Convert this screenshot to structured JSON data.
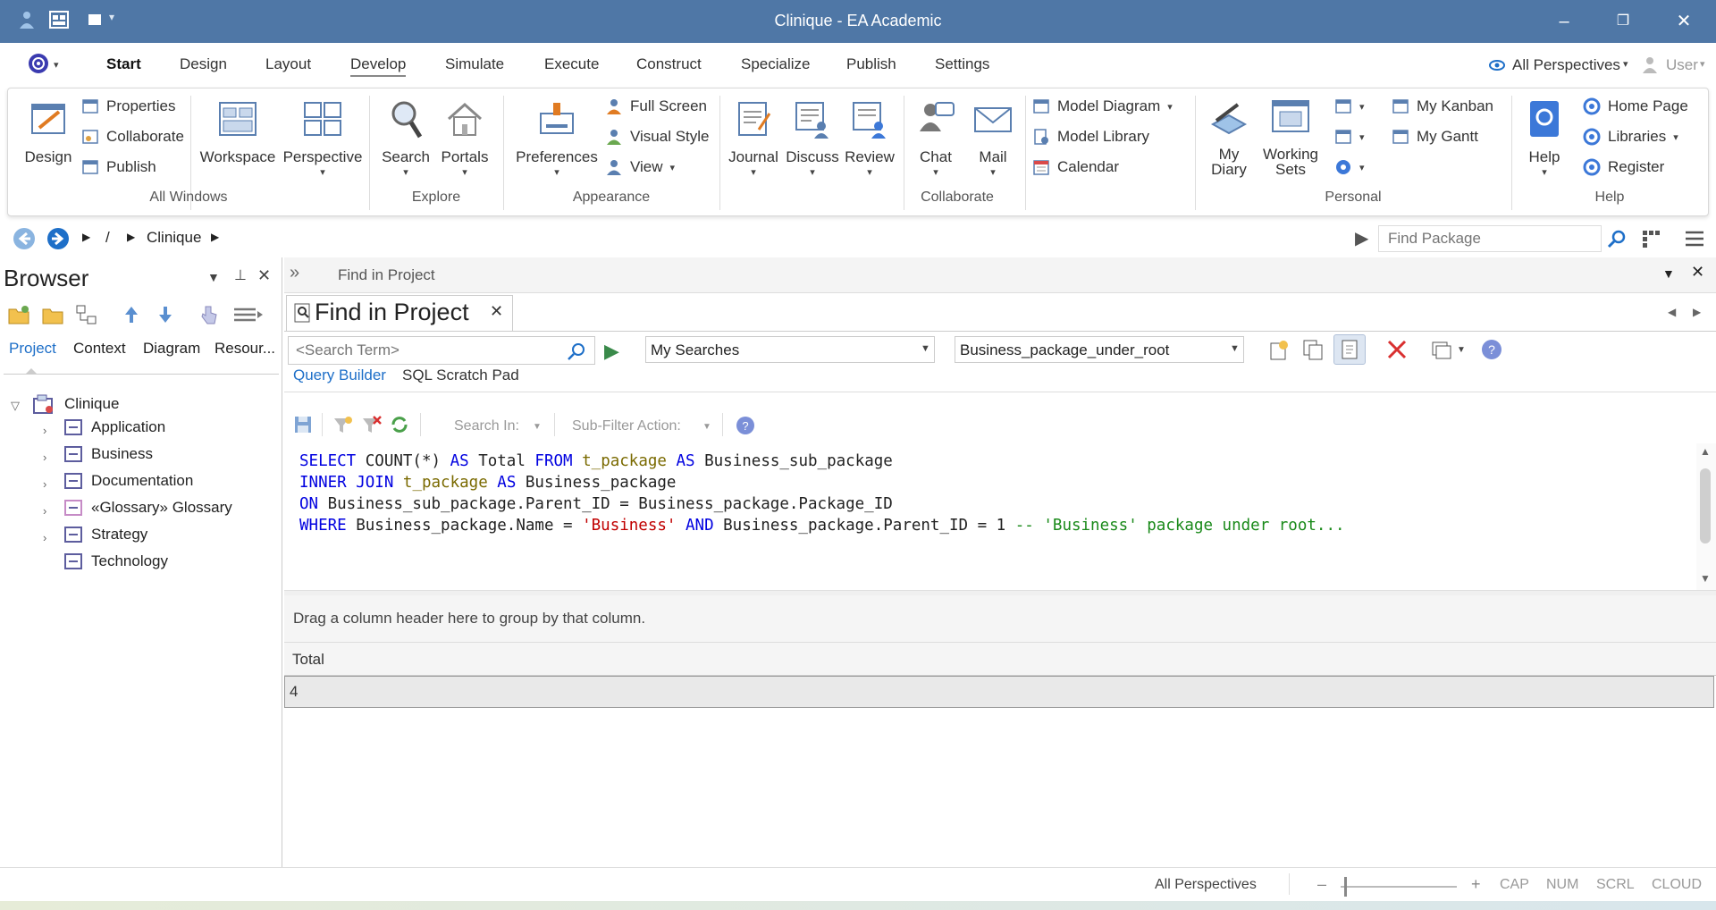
{
  "window": {
    "title": "Clinique - EA Academic"
  },
  "tabs": [
    "Start",
    "Design",
    "Layout",
    "Develop",
    "Simulate",
    "Execute",
    "Construct",
    "Specialize",
    "Publish",
    "Settings"
  ],
  "perspective": {
    "label": "All Perspectives"
  },
  "user": {
    "label": "User"
  },
  "ribbon": {
    "all_windows": {
      "group": "All Windows",
      "design": "Design",
      "properties": "Properties",
      "collaborate": "Collaborate",
      "publish": "Publish",
      "workspace": "Workspace",
      "perspective": "Perspective"
    },
    "explore": {
      "group": "Explore",
      "search": "Search",
      "portals": "Portals"
    },
    "appearance": {
      "group": "Appearance",
      "preferences": "Preferences",
      "full_screen": "Full Screen",
      "visual_style": "Visual Style",
      "view": "View"
    },
    "collaborate": {
      "group": "Collaborate",
      "journal": "Journal",
      "discuss": "Discuss",
      "review": "Review",
      "chat": "Chat",
      "mail": "Mail",
      "model_diagram": "Model Diagram",
      "model_library": "Model Library",
      "calendar": "Calendar"
    },
    "personal": {
      "group": "Personal",
      "my_diary_1": "My",
      "my_diary_2": "Diary",
      "working_sets_1": "Working",
      "working_sets_2": "Sets",
      "my_kanban": "My Kanban",
      "my_gantt": "My Gantt"
    },
    "help": {
      "group": "Help",
      "help": "Help",
      "home_page": "Home Page",
      "libraries": "Libraries",
      "register": "Register"
    }
  },
  "address": {
    "root": "/",
    "crumb": "Clinique",
    "find_placeholder": "Find Package"
  },
  "browser": {
    "title": "Browser",
    "tabs": [
      "Project",
      "Context",
      "Diagram",
      "Resour..."
    ],
    "root": "Clinique",
    "items": [
      "Application",
      "Business",
      "Documentation",
      "«Glossary» Glossary",
      "Strategy",
      "Technology"
    ]
  },
  "find": {
    "header": "Find in Project",
    "tab_title": "Find in Project",
    "search_placeholder": "<Search Term>",
    "search_group": "My Searches",
    "search_name": "Business_package_under_root",
    "subtabs": [
      "Query Builder",
      "SQL Scratch Pad"
    ],
    "search_in": "Search In:",
    "subfilter": "Sub-Filter Action:",
    "sql": {
      "l1": [
        "SELECT",
        " COUNT(*) ",
        "AS",
        " Total ",
        "FROM",
        " ",
        "t_package",
        " ",
        "AS",
        " Business_sub_package"
      ],
      "l2": [
        "INNER JOIN",
        " ",
        "t_package",
        " ",
        "AS",
        " Business_package"
      ],
      "l3": [
        "ON",
        " Business_sub_package.Parent_ID = Business_package.Package_ID"
      ],
      "l4": [
        "WHERE",
        " Business_package.Name = ",
        "'Business'",
        " ",
        "AND",
        " Business_package.Parent_ID = 1 ",
        "-- 'Business' package under root..."
      ]
    },
    "group_hint": "Drag a column header here to group by that column.",
    "columns": [
      "Total"
    ],
    "rows": [
      [
        "4"
      ]
    ]
  },
  "status": {
    "perspective": "All Perspectives",
    "zoom_minus": "–",
    "zoom_plus": "+",
    "flags": [
      "CAP",
      "NUM",
      "SCRL",
      "CLOUD"
    ]
  },
  "colors": {
    "titlebar": "#4f77a6",
    "accent": "#1e6fc8"
  }
}
